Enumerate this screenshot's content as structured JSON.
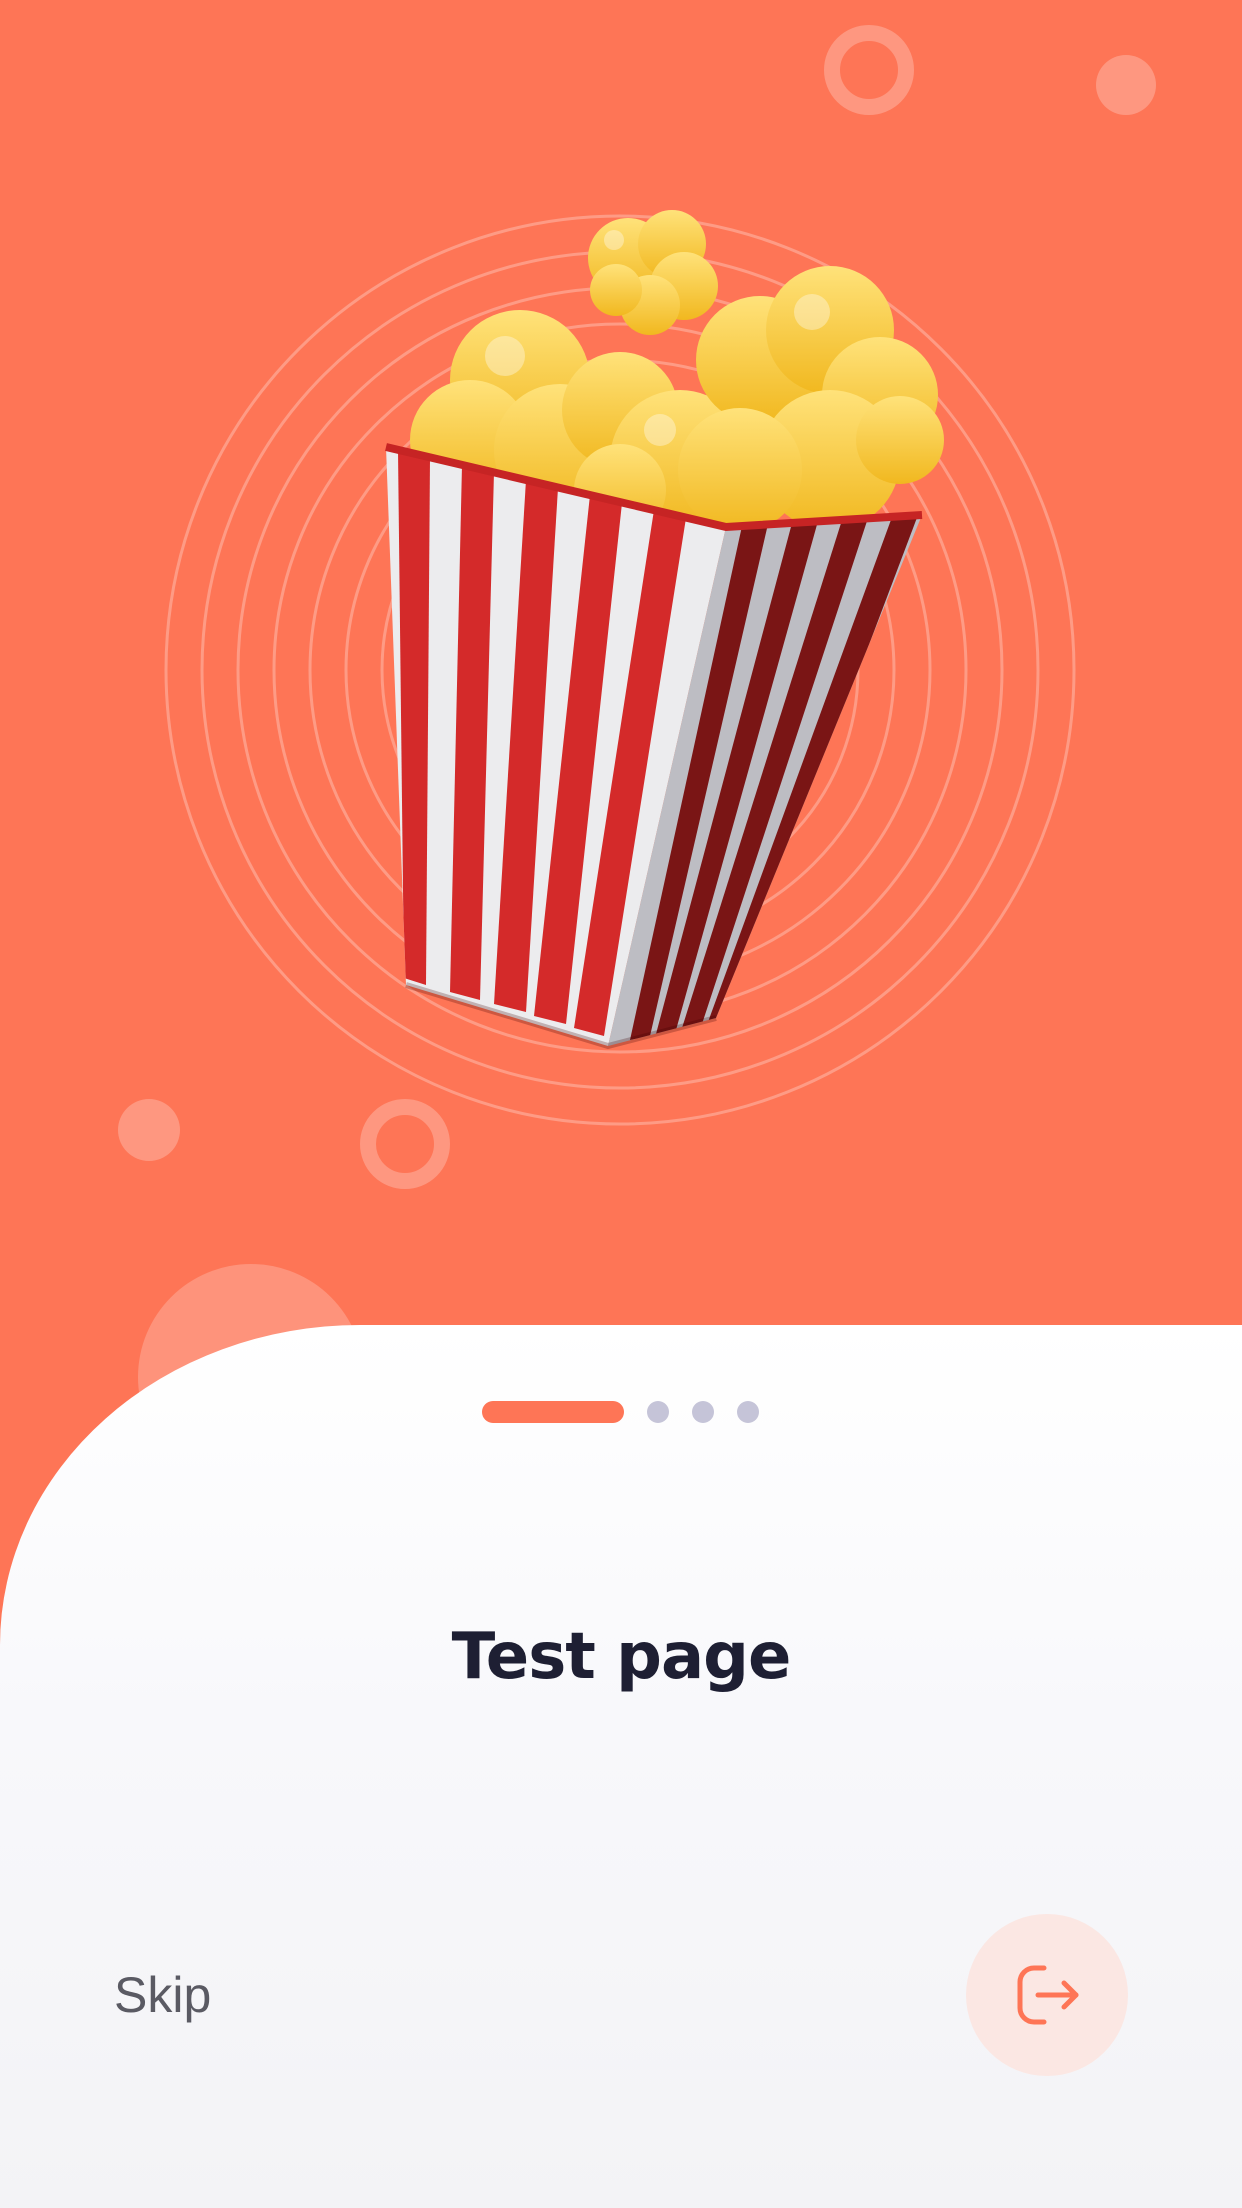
{
  "screen": {
    "title": "Test page",
    "skip_label": "Skip"
  },
  "pager": {
    "total": 4,
    "active_index": 0
  },
  "icons": {
    "illustration": "popcorn-bucket-illustration",
    "next": "login-arrow-icon"
  },
  "colors": {
    "accent": "#FE7556",
    "title": "#1E1F33",
    "skip": "#5A5A63",
    "inactive_dot": "#C5C4D8",
    "next_button_bg": "#FBE7E3"
  }
}
